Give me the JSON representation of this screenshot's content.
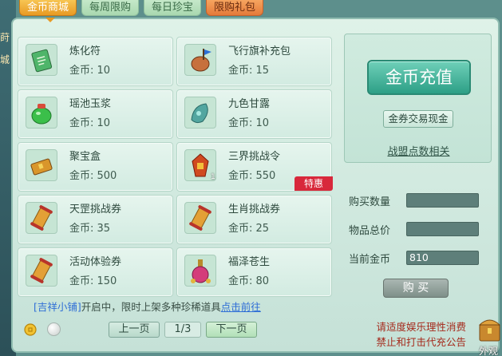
{
  "side_text": [
    "莳",
    "城"
  ],
  "tabs": [
    {
      "label": "金币商城"
    },
    {
      "label": "每周限购"
    },
    {
      "label": "每日珍宝"
    },
    {
      "label": "限购礼包"
    }
  ],
  "price_prefix": "金币: ",
  "items": [
    {
      "name": "炼化符",
      "price": "金币: 10",
      "icon": "talisman-icon",
      "color": "#4fb56a"
    },
    {
      "name": "飞行旗补充包",
      "price": "金币: 15",
      "icon": "flag-bag-icon",
      "color": "#c7703d"
    },
    {
      "name": "瑶池玉浆",
      "price": "金币: 10",
      "icon": "jade-jar-icon",
      "color": "#3bbf4a"
    },
    {
      "name": "九色甘露",
      "price": "金币: 10",
      "icon": "nectar-icon",
      "color": "#52a6a0"
    },
    {
      "name": "聚宝盒",
      "price": "金币: 500",
      "icon": "treasure-box-icon",
      "color": "#d9962b"
    },
    {
      "name": "三界挑战令",
      "price": "金币: 550",
      "icon": "challenge-token-icon",
      "color": "#d04a1f",
      "count": "1",
      "tag": "特惠"
    },
    {
      "name": "天罡挑战券",
      "price": "金币: 35",
      "icon": "scroll-icon",
      "color": "#e3a036"
    },
    {
      "name": "生肖挑战券",
      "price": "金币: 25",
      "icon": "scroll-icon",
      "color": "#e3a036"
    },
    {
      "name": "活动体验券",
      "price": "金币: 150",
      "icon": "scroll-icon",
      "color": "#e3a036"
    },
    {
      "name": "福泽苍生",
      "price": "金币: 80",
      "icon": "potion-bottle-icon",
      "color": "#d43c7a"
    }
  ],
  "notice": {
    "shop": "[吉祥小铺]",
    "text": "开启中，限时上架多种珍稀道具",
    "link": "点击前往"
  },
  "pagination": {
    "prev": "上一页",
    "page": "1/3",
    "next": "下一页"
  },
  "right": {
    "recharge": "金币充值",
    "exchange": "金券交易现金",
    "guild": "战盟点数相关"
  },
  "form": {
    "qty_label": "购买数量",
    "qty_value": "",
    "total_label": "物品总价",
    "total_value": "",
    "current_label": "当前金币",
    "current_value": "810",
    "buy": "购 买"
  },
  "footer": {
    "line1": "请适度娱乐理性消费",
    "line2": "禁止和打击代充公告"
  },
  "outside_label": "外观",
  "colors": {
    "accent": "#2d9f86",
    "tab_active": "#e89a23",
    "tag": "#d8283b",
    "warning": "#a52a1c",
    "link": "#2f6ed6"
  }
}
